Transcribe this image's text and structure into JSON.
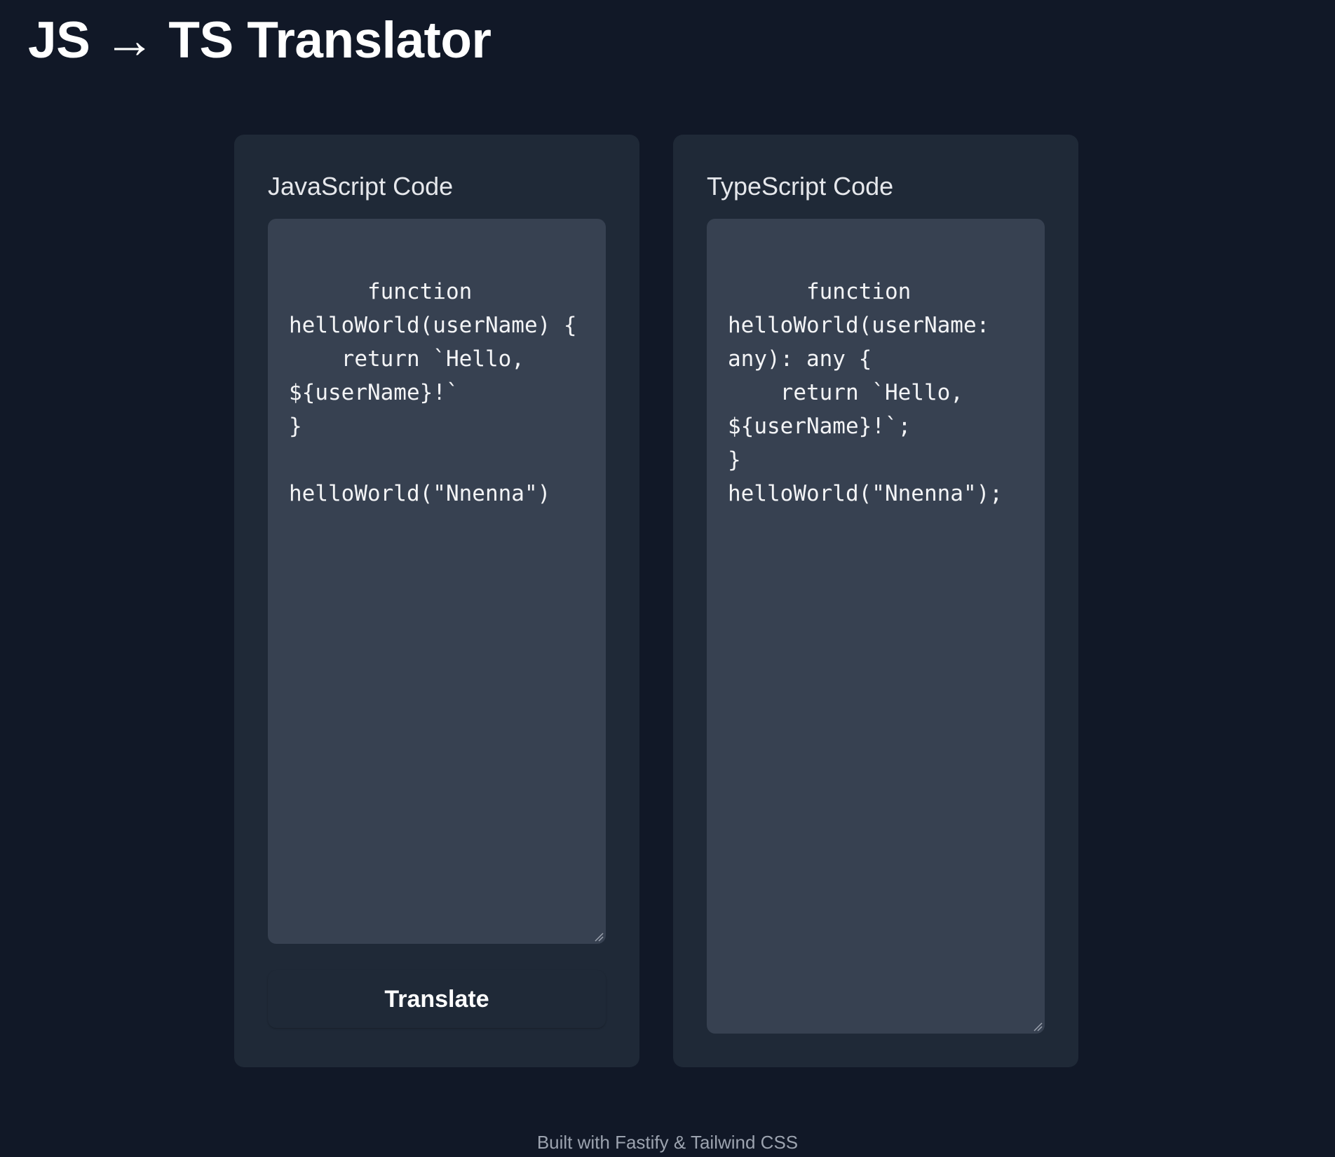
{
  "header": {
    "title": "JS → TS Translator"
  },
  "input_panel": {
    "label": "JavaScript Code",
    "code": "function helloWorld(userName) {\n    return `Hello, ${userName}!`\n}\n\nhelloWorld(\"Nnenna\")",
    "button_label": "Translate"
  },
  "output_panel": {
    "label": "TypeScript Code",
    "code": "function helloWorld(userName: any): any {\n    return `Hello, ${userName}!`;\n}\nhelloWorld(\"Nnenna\");"
  },
  "footer": {
    "text": "Built with Fastify & Tailwind CSS"
  },
  "colors": {
    "background": "#111827",
    "panel": "#1f2937",
    "textarea": "#374151",
    "footer_text": "#9ca3af"
  }
}
